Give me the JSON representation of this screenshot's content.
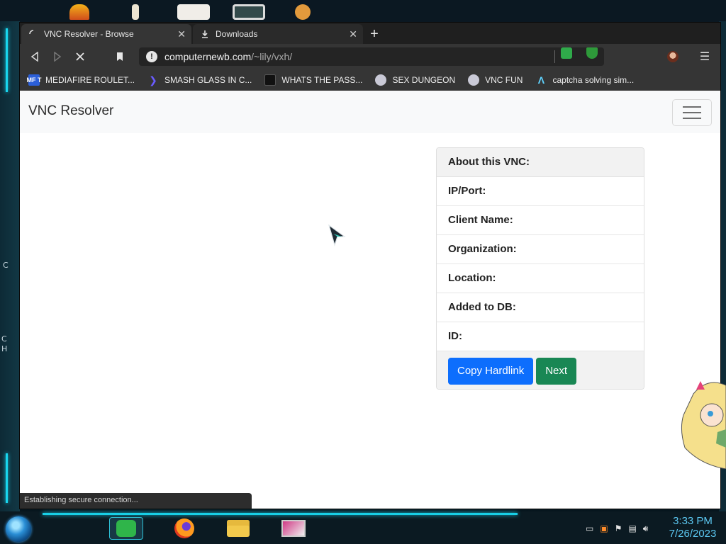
{
  "browser": {
    "tabs": [
      {
        "label": "VNC Resolver - Browse",
        "active": true,
        "loading": true
      },
      {
        "label": "Downloads",
        "active": false
      }
    ],
    "url": {
      "host": "computernewb.com",
      "path": "/~lily/vxh/"
    },
    "bookmarks": [
      {
        "label": "MEDIAFIRE ROULET...",
        "icon": "mediafire-icon",
        "icon_text": "MF T"
      },
      {
        "label": "SMASH GLASS IN C...",
        "icon": "chevron-bookmark-icon"
      },
      {
        "label": "WHATS THE PASS...",
        "icon": "dark-square-icon"
      },
      {
        "label": "SEX DUNGEON",
        "icon": "helmet-icon"
      },
      {
        "label": "VNC FUN",
        "icon": "helmet-icon"
      },
      {
        "label": "captcha solving sim...",
        "icon": "arch-icon"
      }
    ],
    "status_text": "Establishing secure connection..."
  },
  "page": {
    "brand": "VNC Resolver",
    "card": {
      "header": "About this VNC:",
      "rows": [
        "IP/Port:",
        "Client Name:",
        "Organization:",
        "Location:",
        "Added to DB:",
        "ID:"
      ],
      "buttons": {
        "copy": "Copy Hardlink",
        "next": "Next"
      }
    }
  },
  "taskbar": {
    "apps": [
      {
        "name": "notes-app",
        "icon": "notes-icon",
        "active": true
      },
      {
        "name": "firefox-app",
        "icon": "firefox-icon",
        "active": false
      },
      {
        "name": "file-explorer-app",
        "icon": "folder-icon",
        "active": false
      },
      {
        "name": "media-app",
        "icon": "monitor-icon",
        "active": false
      }
    ],
    "clock": {
      "time": "3:33 PM",
      "date": "7/26/2023"
    }
  },
  "desktop": {
    "edge_glyphs": [
      "C",
      "C",
      "H"
    ]
  },
  "colors": {
    "primary_button": "#0d6efd",
    "success_button": "#198754",
    "neon_accent": "#19d7f0",
    "clock": "#5cc8f2"
  }
}
